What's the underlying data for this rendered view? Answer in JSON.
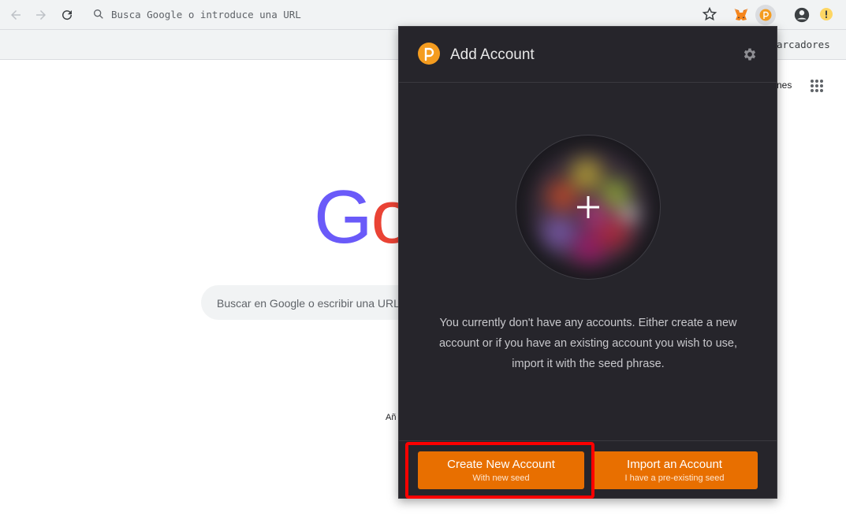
{
  "browser": {
    "omnibox_placeholder": "Busca Google o introduce una URL",
    "bookmarks_label": "arcadores"
  },
  "google": {
    "apps_partial": "nes",
    "search_placeholder": "Buscar en Google o escribir una URL",
    "footer_partial": "Añ"
  },
  "popup": {
    "title": "Add Account",
    "message": "You currently don't have any accounts. Either create a new account or if you have an existing account you wish to use, import it with the seed phrase.",
    "buttons": {
      "create_main": "Create New Account",
      "create_sub": "With new seed",
      "import_main": "Import an Account",
      "import_sub": "I have a pre-existing seed"
    }
  },
  "colors": {
    "accent": "#e86f00",
    "popup_bg": "#26252b",
    "highlight": "#ff0000"
  }
}
